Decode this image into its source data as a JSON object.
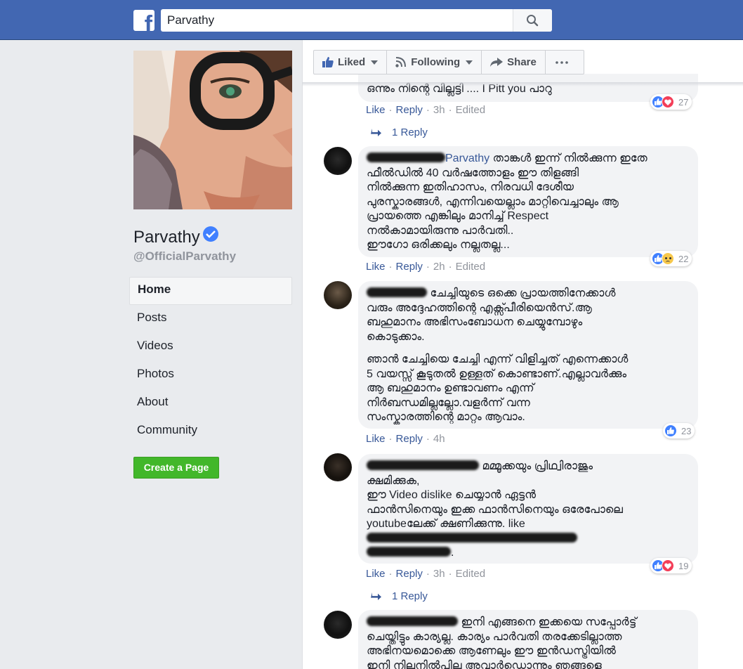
{
  "search": {
    "value": "Parvathy"
  },
  "page": {
    "name": "Parvathy",
    "handle": "@OfficialParvathy"
  },
  "nav": {
    "items": [
      {
        "label": "Home"
      },
      {
        "label": "Posts"
      },
      {
        "label": "Videos"
      },
      {
        "label": "Photos"
      },
      {
        "label": "About"
      },
      {
        "label": "Community"
      }
    ]
  },
  "create_page_label": "Create a Page",
  "actions": {
    "liked": "Liked",
    "following": "Following",
    "share": "Share"
  },
  "comments": [
    {
      "text": "ഒന്നും നിന്റെ വില്ലട്ടി .... I Pitt you പാറു",
      "like": "Like",
      "reply": "Reply",
      "time": "3h",
      "edited": "Edited",
      "reactions": "27",
      "replies": "1 Reply"
    },
    {
      "name": "Parvathy",
      "lines": [
        "താങ്കൾ ഇന്ന് നിൽക്കുന്ന ഇതേ",
        "ഫീൽഡിൽ 40 വർഷത്തോളം ഈ തിളങ്ങി",
        "നിൽക്കുന്ന ഇതിഹാസം, നിരവധി ദേശീയ",
        "പുരസ്കാരങ്ങൾ, എന്നിവയെല്ലാം മാറ്റിവെച്ചാലും ആ",
        "പ്രായത്തെ എങ്കിലും മാനിച്ച് Respect",
        "നൽകാമായിരുന്നു പാർവതി..",
        "ഈഗോ ഒരിക്കലും നല്ലതല്ല..."
      ],
      "like": "Like",
      "reply": "Reply",
      "time": "2h",
      "edited": "Edited",
      "reactions": "22"
    },
    {
      "lines": [
        "ചേച്ചിയുടെ ഒക്കെ പ്രായത്തിനേക്കാൾ",
        "വരും അദ്ദേഹത്തിന്റെ എക്സ്പീരിയെൻസ്.ആ",
        "ബഹുമാനം അഭിസംബോധന ചെയ്യുമ്പോഴും",
        "കൊടുക്കാം."
      ],
      "lines2": [
        "ഞാൻ ചേച്ചിയെ ചേച്ചി എന്ന് വിളിച്ചത് എന്നെക്കാൾ",
        "5 വയസ്സ് കൂടുതൽ ഉള്ളത് കൊണ്ടാണ്.എല്ലാവർക്കും",
        "ആ ബഹുമാനം ഉണ്ടാവണം എന്ന്",
        "നിർബന്ധമില്ലല്ലോ.വളർന്ന് വന്ന",
        "സംസ്കാരത്തിന്റെ മാറ്റം ആവാം."
      ],
      "like": "Like",
      "reply": "Reply",
      "time": "4h",
      "reactions": "23"
    },
    {
      "lines": [
        "മമ്മൂക്കയും പ്രിഥ്വിരാജും",
        "ക്ഷമിക്കുക,",
        "ഈ        Video dislike ചെയ്യാൻ ഏട്ടൻ",
        "ഫാൻസിനെയും ഇക്ക ഫാൻസിനെയും ഒരേപോലെ",
        "youtubeലേക്ക് ക്ഷണിക്കുന്നു.                 like",
        "                                     ം",
        "                    ."
      ],
      "like": "Like",
      "reply": "Reply",
      "time": "3h",
      "edited": "Edited",
      "reactions": "19",
      "replies": "1 Reply"
    },
    {
      "lines": [
        "ഇനി എങ്ങനെ ഇക്കയെ സപ്പോർട്ട്",
        "ചെയ്തിട്ടും കാര്യല്ല. കാര്യം പാർവതി തരക്കേടില്ലാത്ത",
        "അഭിനയമൊക്കെ ആണേലും ഈ ഇൻഡസ്ട്രിയിൽ",
        "ഇനി നിലനിൽപില്ല അവാർഡൊന്നും ഞങ്ങളെ"
      ]
    }
  ]
}
